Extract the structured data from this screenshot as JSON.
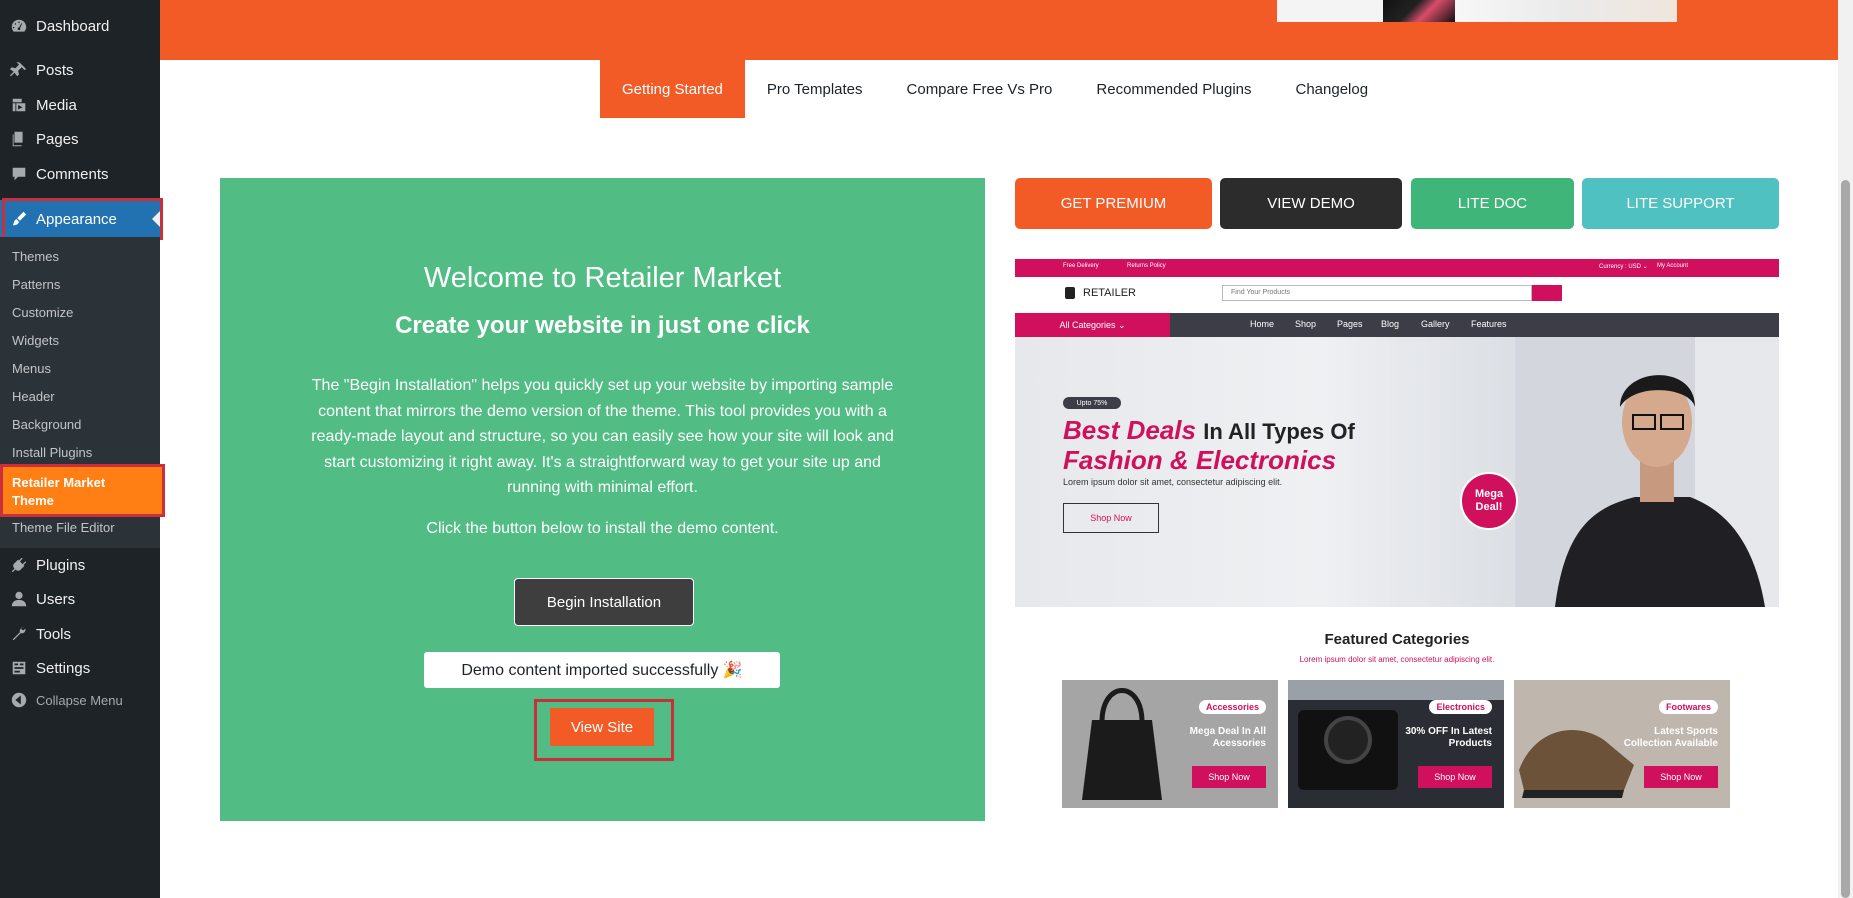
{
  "sidebar": {
    "dashboard": "Dashboard",
    "posts": "Posts",
    "media": "Media",
    "pages": "Pages",
    "comments": "Comments",
    "appearance": "Appearance",
    "submenu": [
      "Themes",
      "Patterns",
      "Customize",
      "Widgets",
      "Menus",
      "Header",
      "Background",
      "Install Plugins"
    ],
    "current_sub": "Retailer Market Theme",
    "theme_file_editor": "Theme File Editor",
    "plugins": "Plugins",
    "users": "Users",
    "tools": "Tools",
    "settings": "Settings",
    "collapse": "Collapse Menu"
  },
  "tabs": [
    "Getting Started",
    "Pro Templates",
    "Compare Free Vs Pro",
    "Recommended Plugins",
    "Changelog"
  ],
  "welcome": {
    "title": "Welcome to Retailer Market",
    "subtitle": "Create your website in just one click",
    "description": "The \"Begin Installation\" helps you quickly set up your website by importing sample content that mirrors the demo version of the theme. This tool provides you with a ready-made layout and structure, so you can easily see how your site will look and start customizing it right away. It's a straightforward way to get your site up and running with minimal effort.",
    "click_text": "Click the button below to install the demo content.",
    "begin_button": "Begin Installation",
    "success_msg": "Demo content imported successfully 🎉",
    "view_site": "View Site"
  },
  "actions": {
    "premium": "GET PREMIUM",
    "demo": "VIEW DEMO",
    "doc": "LITE DOC",
    "support": "LITE SUPPORT"
  },
  "preview": {
    "free_delivery": "Free Delivery",
    "returns": "Returns Policy",
    "currency": "Currency : USD ⌄",
    "account": "My Account",
    "brand": "RETAILER",
    "search_placeholder": "Find Your Products",
    "all_categories": "All Categories ⌄",
    "nav": [
      "Home",
      "Shop",
      "Pages",
      "Blog",
      "Gallery",
      "Features"
    ],
    "upto": "Upto 75%",
    "headline_1": "Best Deals",
    "headline_1b": "In All Types Of",
    "headline_2": "Fashion & Electronics",
    "lorem": "Lorem ipsum dolor sit amet, consectetur adipiscing elit.",
    "shop_now": "Shop Now",
    "mega": "Mega Deal!",
    "featured_title": "Featured Categories",
    "featured_sub": "Lorem ipsum dolor sit amet, consectetur adipiscing elit.",
    "cards": [
      {
        "tag": "Accessories",
        "text": "Mega Deal In All Acessories",
        "btn": "Shop Now"
      },
      {
        "tag": "Electronics",
        "text": "30% OFF In Latest Products",
        "btn": "Shop Now"
      },
      {
        "tag": "Footwares",
        "text": "Latest Sports Collection Available",
        "btn": "Shop Now"
      }
    ]
  },
  "colors": {
    "sidebar_bg": "#1d2327",
    "accent_orange": "#f35b26",
    "current_sub": "#ff7f14",
    "wp_blue": "#2271b1",
    "green_panel": "#51bd84",
    "demo_dark": "#2c2c2c",
    "doc_green": "#3fb57a",
    "support_teal": "#4fc1c0",
    "preview_pink": "#d0105d"
  }
}
